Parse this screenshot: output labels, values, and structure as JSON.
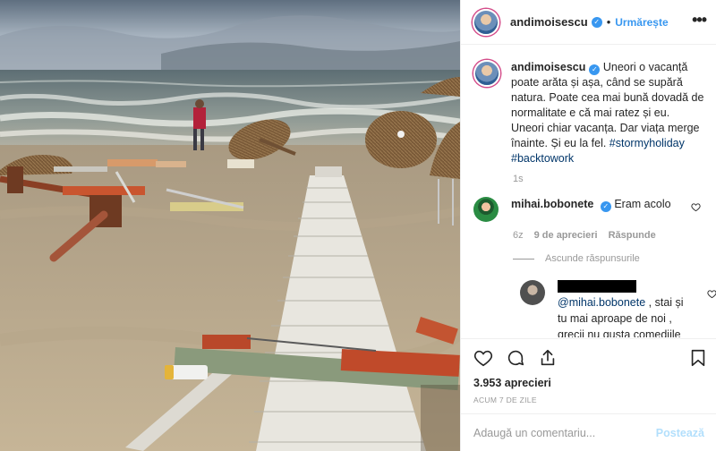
{
  "photo": {
    "alt_icon": "beach-storm-photo"
  },
  "header": {
    "username": "andimoisescu",
    "verified_mark": "✓",
    "separator": "•",
    "follow_label": "Urmărește",
    "more_label": "•••"
  },
  "caption": {
    "username": "andimoisescu",
    "text": " Uneori o vacanță poate arăta și așa, când se supără natura. Poate cea mai bună dovadă de normalitate e că mai ratez și eu. Uneori chiar vacanța. Dar viața merge înainte. Și eu la fel. ",
    "hashtag1": "#stormyholiday",
    "hashtag2": "#backtowork",
    "age": "1s"
  },
  "comments": [
    {
      "username": "mihai.bobonete",
      "text": "Eram acolo",
      "age": "6z",
      "date": "9 de aprecieri",
      "reply_label": "Răspunde",
      "hide_replies_label": "Ascunde răspunsurile"
    }
  ],
  "reply": {
    "mention": "@mihai.bobonete",
    "text": " , stai și tu mai aproape de noi , grecii nu gusta comediile ca noi romanii , astia le au cu"
  },
  "actions": {
    "likes": "3.953 aprecieri",
    "post_age": "ACUM 7 DE ZILE"
  },
  "add_comment": {
    "placeholder": "Adaugă un comentariu...",
    "post_label": "Postează"
  },
  "colors": {
    "accent": "#3897f0",
    "hashtag": "#003569",
    "muted": "#999999",
    "post_disabled": "#b2dffc"
  }
}
